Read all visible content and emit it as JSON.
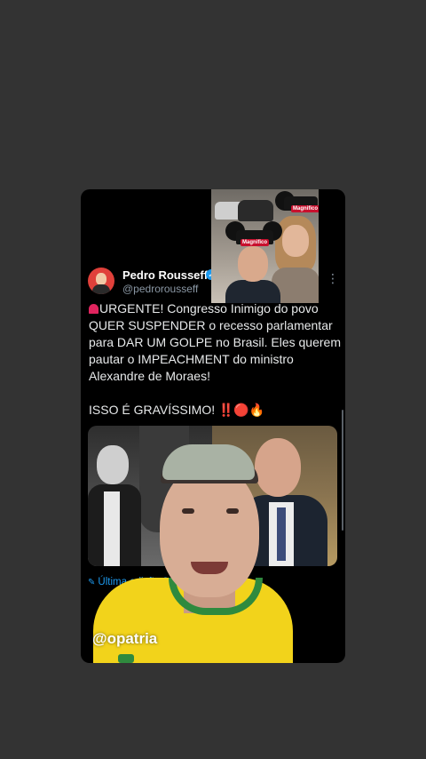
{
  "tweet": {
    "author_name": "Pedro Rousseff",
    "handle": "@pedrorousseff",
    "line1": "URGENTE! Congresso Inimigo do povo",
    "line2": "QUER SUSPENDER o recesso parlamentar",
    "line3": "para DAR UM GOLPE no Brasil. Eles querem",
    "line4": "pautar o IMPEACHMENT do ministro",
    "line5": "Alexandre de Moraes!",
    "line6": "ISSO É GRAVÍSSIMO! ‼️🔴🔥",
    "more_icon": "⋮",
    "verified_icon": "✓",
    "edited_label": "Última edição 2"
  },
  "meme_overlay": {
    "hat_label_1": "Magnifico",
    "hat_label_2": "Magnifico"
  },
  "video_overlay": {
    "watermark": "@opatria"
  },
  "colors": {
    "background": "#333333",
    "card": "#000000",
    "accent_blue": "#1d9bf0",
    "shirt_yellow": "#f2d31b",
    "shirt_green": "#2f8a3e"
  }
}
